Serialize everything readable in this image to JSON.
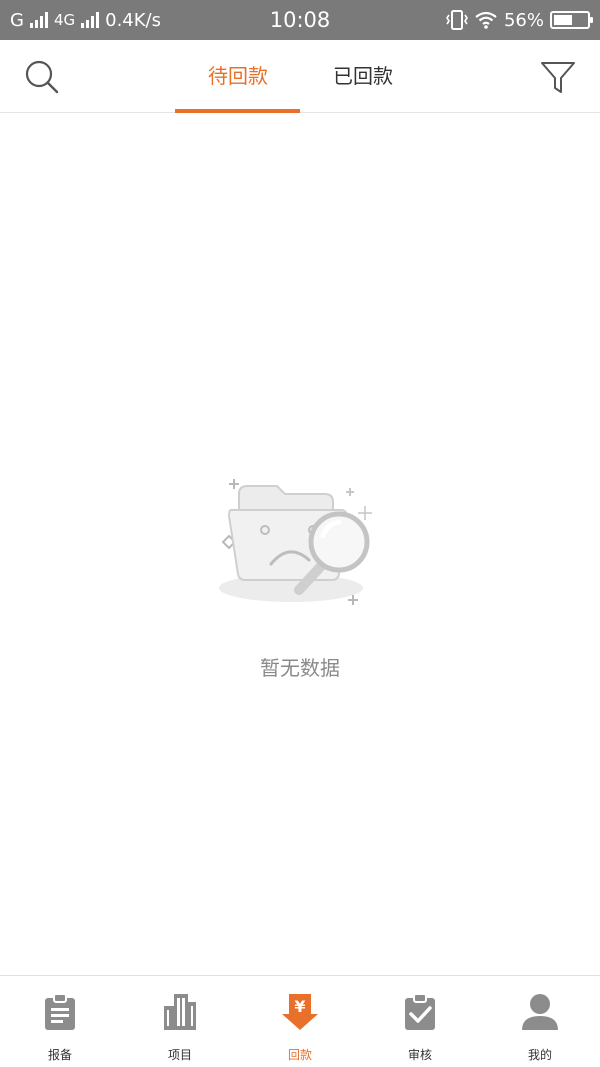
{
  "status_bar": {
    "carrier": "G",
    "network": "4G",
    "speed": "0.4K/s",
    "time": "10:08",
    "battery_text": "56%",
    "battery_level": 0.56
  },
  "header": {
    "tabs": [
      {
        "label": "待回款",
        "active": true
      },
      {
        "label": "已回款",
        "active": false
      }
    ]
  },
  "empty_state": {
    "text": "暂无数据"
  },
  "bottom_nav": {
    "items": [
      {
        "label": "报备",
        "icon": "clipboard-icon",
        "active": false
      },
      {
        "label": "项目",
        "icon": "building-icon",
        "active": false
      },
      {
        "label": "回款",
        "icon": "yen-download-icon",
        "active": true
      },
      {
        "label": "审核",
        "icon": "check-clipboard-icon",
        "active": false
      },
      {
        "label": "我的",
        "icon": "user-icon",
        "active": false
      }
    ]
  },
  "colors": {
    "accent": "#e8702a",
    "status_bar": "#7a7a7a",
    "icon_gray": "#8c8c8c",
    "text_muted": "#8a8a8a"
  }
}
